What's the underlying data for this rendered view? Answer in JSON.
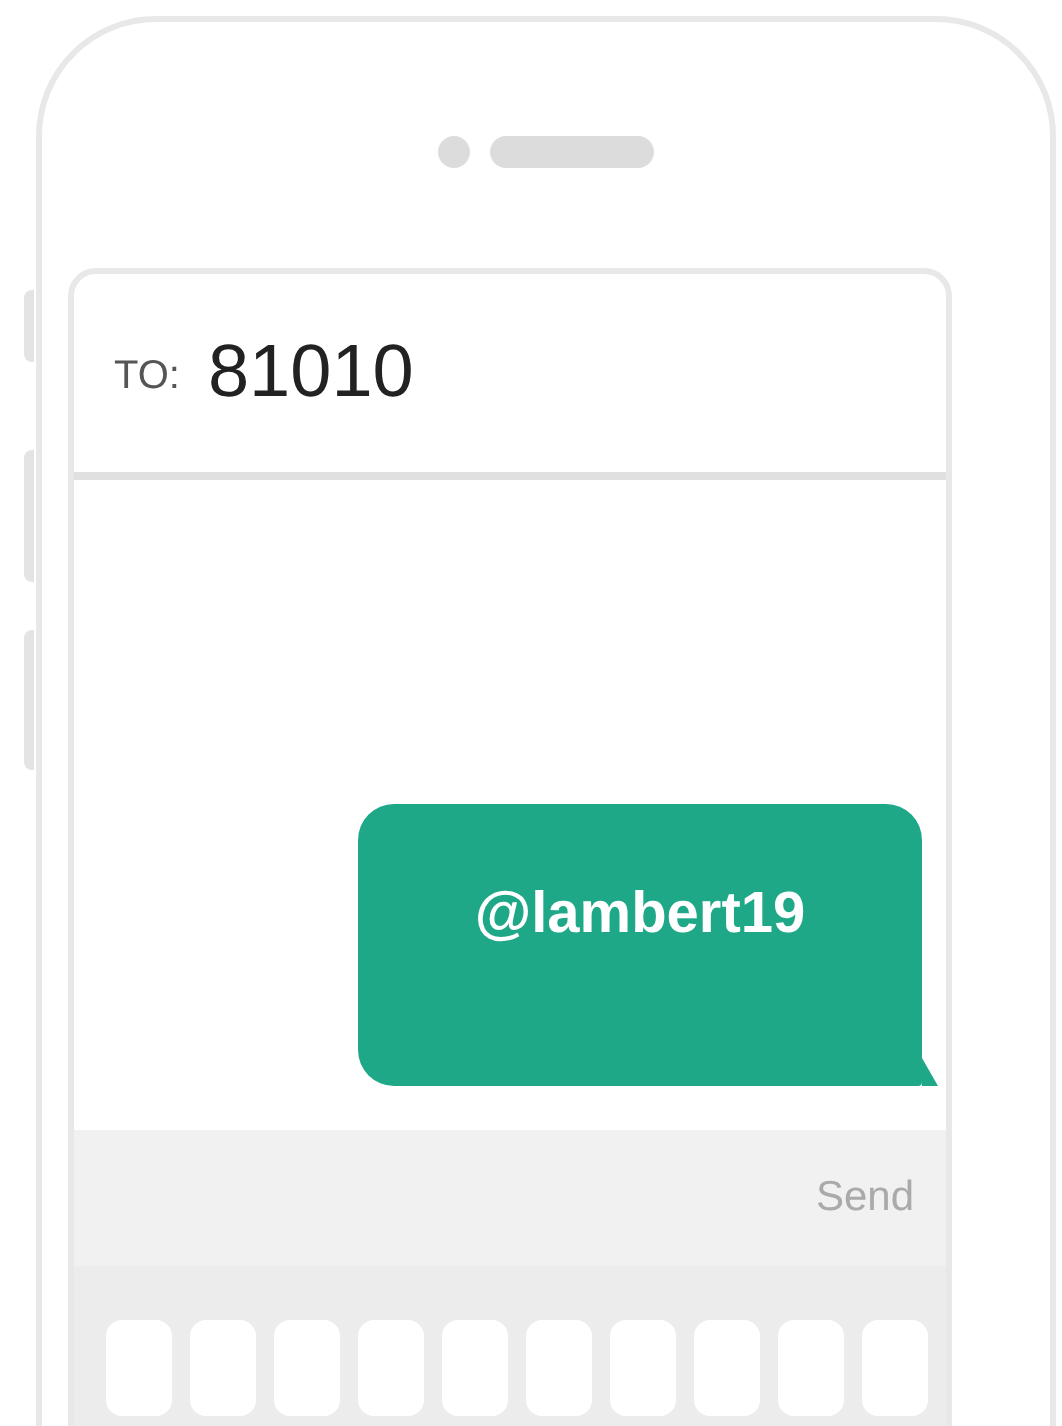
{
  "recipient": {
    "label": "TO:",
    "value": "81010"
  },
  "messages": [
    {
      "text": "@lambert19",
      "kind": "sent"
    }
  ],
  "compose": {
    "send_label": "Send"
  }
}
